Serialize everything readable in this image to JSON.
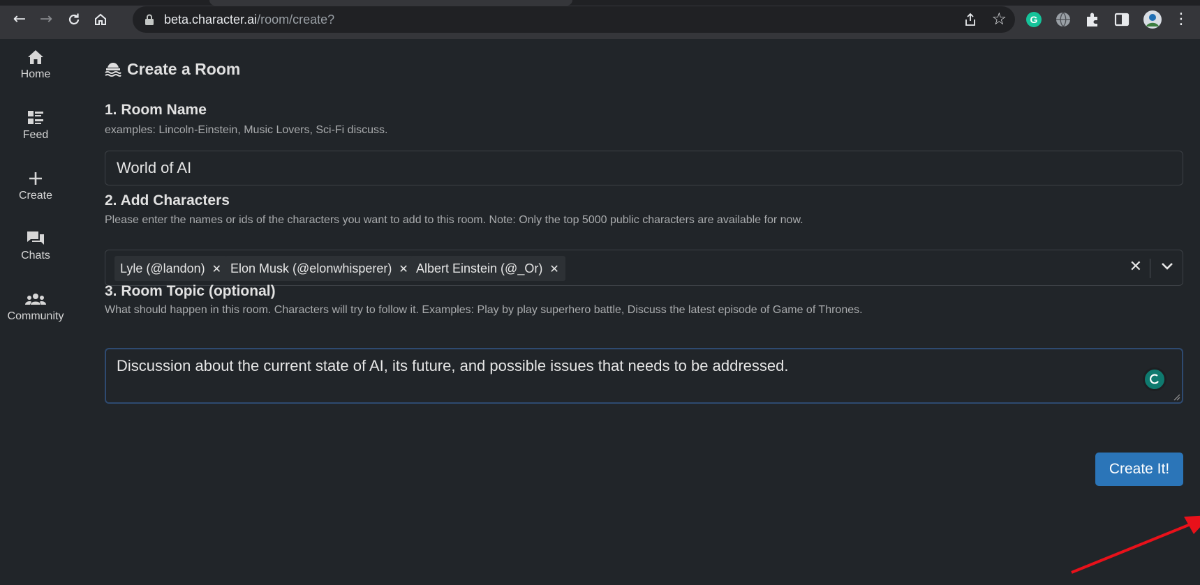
{
  "browser": {
    "url_host": "beta.character.ai",
    "url_path": "/room/create?"
  },
  "sidebar": {
    "items": [
      {
        "label": "Home",
        "icon": "home-icon"
      },
      {
        "label": "Feed",
        "icon": "feed-icon"
      },
      {
        "label": "Create",
        "icon": "plus-icon"
      },
      {
        "label": "Chats",
        "icon": "chat-icon"
      },
      {
        "label": "Community",
        "icon": "community-icon"
      }
    ]
  },
  "page": {
    "title": "Create a Room"
  },
  "room_name": {
    "title": "1. Room Name",
    "help": "examples: Lincoln-Einstein, Music Lovers, Sci-Fi discuss.",
    "value": "World of AI"
  },
  "characters": {
    "title": "2. Add Characters",
    "help": "Please enter the names or ids of the characters you want to add to this room. Note: Only the top 5000 public characters are available for now.",
    "chips": [
      {
        "label": "Lyle (@landon)"
      },
      {
        "label": "Elon Musk (@elonwhisperer)"
      },
      {
        "label": "Albert Einstein (@_Or)"
      }
    ]
  },
  "topic": {
    "title": "3. Room Topic (optional)",
    "help": "What should happen in this room. Characters will try to follow it. Examples: Play by play superhero battle, Discuss the latest episode of Game of Thrones.",
    "value": "Discussion about the current state of AI, its future, and possible issues that needs to be addressed."
  },
  "actions": {
    "create_label": "Create It!",
    "primary_color": "#2b75b8",
    "annotation_arrow_color": "#e8111a"
  }
}
